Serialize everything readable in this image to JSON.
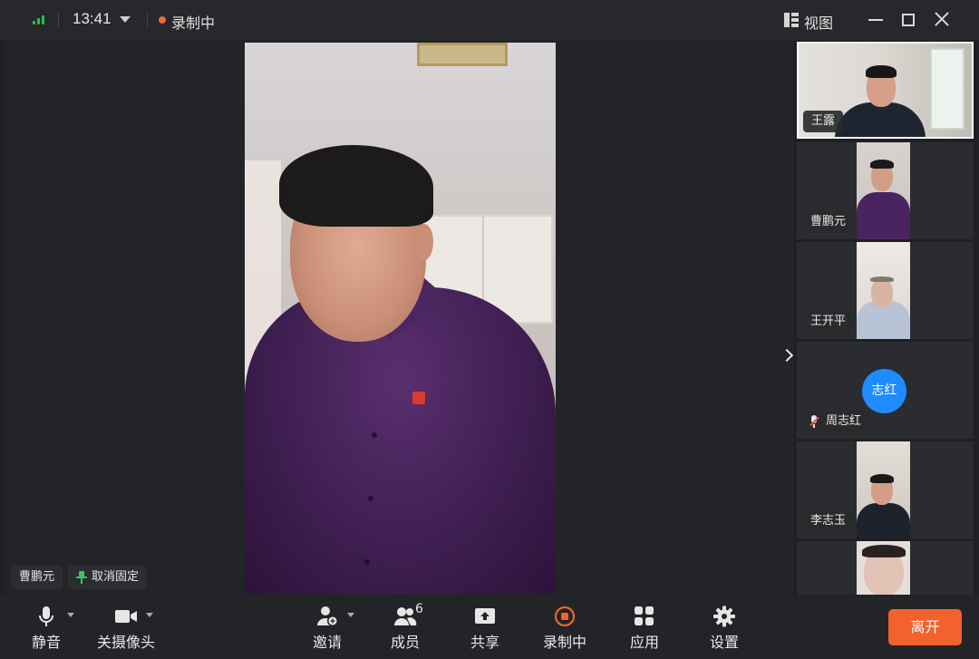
{
  "titlebar": {
    "time": "13:41",
    "recording_status": "录制中",
    "view_label": "视图"
  },
  "main_video": {
    "participant_name": "曹鹏元",
    "unpin_label": "取消固定"
  },
  "sidebar": {
    "participants": [
      {
        "name": "王露",
        "video": true,
        "active": true
      },
      {
        "name": "曹鹏元",
        "video": true
      },
      {
        "name": "王开平",
        "video": true
      },
      {
        "name": "周志红",
        "video": false,
        "avatar_text": "志红",
        "muted": true
      },
      {
        "name": "李志玉",
        "video": true
      },
      {
        "name": "",
        "video": true
      }
    ]
  },
  "toolbar": {
    "mute_label": "静音",
    "camera_label": "关摄像头",
    "invite_label": "邀请",
    "members_label": "成员",
    "members_count": "6",
    "share_label": "共享",
    "record_label": "录制中",
    "apps_label": "应用",
    "settings_label": "设置",
    "leave_label": "离开"
  },
  "colors": {
    "accent": "#f3622c",
    "recording": "#f06a35",
    "signal": "#27c24c",
    "avatar": "#1f8bff",
    "pin": "#3fc45b"
  }
}
